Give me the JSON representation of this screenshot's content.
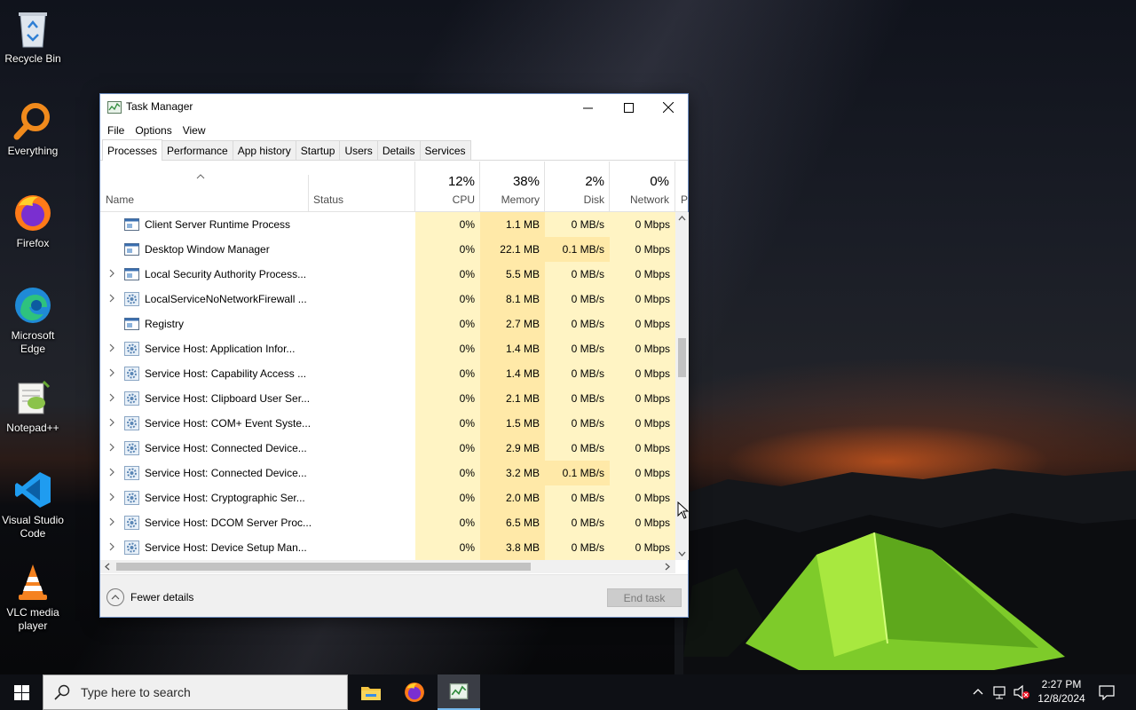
{
  "desktop": {
    "icons": [
      {
        "label": "Recycle Bin",
        "icon": "recycle-bin-icon"
      },
      {
        "label": "Everything",
        "icon": "everything-search-icon"
      },
      {
        "label": "Firefox",
        "icon": "firefox-icon"
      },
      {
        "label": "Microsoft Edge",
        "icon": "edge-icon"
      },
      {
        "label": "Notepad++",
        "icon": "notepadpp-icon"
      },
      {
        "label": "Visual Studio Code",
        "icon": "vscode-icon"
      },
      {
        "label": "VLC media player",
        "icon": "vlc-icon"
      }
    ]
  },
  "window": {
    "title": "Task Manager",
    "menu": [
      "File",
      "Options",
      "View"
    ],
    "tabs": [
      "Processes",
      "Performance",
      "App history",
      "Startup",
      "Users",
      "Details",
      "Services"
    ],
    "active_tab": "Processes",
    "columns": {
      "name": "Name",
      "status": "Status",
      "cpu": {
        "pct": "12%",
        "label": "CPU"
      },
      "memory": {
        "pct": "38%",
        "label": "Memory"
      },
      "disk": {
        "pct": "2%",
        "label": "Disk"
      },
      "network": {
        "pct": "0%",
        "label": "Network"
      },
      "power_partial": "P"
    },
    "processes": [
      {
        "name": "Client Server Runtime Process",
        "expandable": false,
        "icon": "window-icon",
        "cpu": "0%",
        "memory": "1.1 MB",
        "disk": "0 MB/s",
        "network": "0 Mbps"
      },
      {
        "name": "Desktop Window Manager",
        "expandable": false,
        "icon": "window-icon",
        "cpu": "0%",
        "memory": "22.1 MB",
        "disk": "0.1 MB/s",
        "network": "0 Mbps"
      },
      {
        "name": "Local Security Authority Process...",
        "expandable": true,
        "icon": "window-icon",
        "cpu": "0%",
        "memory": "5.5 MB",
        "disk": "0 MB/s",
        "network": "0 Mbps"
      },
      {
        "name": "LocalServiceNoNetworkFirewall ...",
        "expandable": true,
        "icon": "gear-icon",
        "cpu": "0%",
        "memory": "8.1 MB",
        "disk": "0 MB/s",
        "network": "0 Mbps"
      },
      {
        "name": "Registry",
        "expandable": false,
        "icon": "window-icon",
        "cpu": "0%",
        "memory": "2.7 MB",
        "disk": "0 MB/s",
        "network": "0 Mbps"
      },
      {
        "name": "Service Host: Application Infor...",
        "expandable": true,
        "icon": "gear-icon",
        "cpu": "0%",
        "memory": "1.4 MB",
        "disk": "0 MB/s",
        "network": "0 Mbps"
      },
      {
        "name": "Service Host: Capability Access ...",
        "expandable": true,
        "icon": "gear-icon",
        "cpu": "0%",
        "memory": "1.4 MB",
        "disk": "0 MB/s",
        "network": "0 Mbps"
      },
      {
        "name": "Service Host: Clipboard User Ser...",
        "expandable": true,
        "icon": "gear-icon",
        "cpu": "0%",
        "memory": "2.1 MB",
        "disk": "0 MB/s",
        "network": "0 Mbps"
      },
      {
        "name": "Service Host: COM+ Event Syste...",
        "expandable": true,
        "icon": "gear-icon",
        "cpu": "0%",
        "memory": "1.5 MB",
        "disk": "0 MB/s",
        "network": "0 Mbps"
      },
      {
        "name": "Service Host: Connected Device...",
        "expandable": true,
        "icon": "gear-icon",
        "cpu": "0%",
        "memory": "2.9 MB",
        "disk": "0 MB/s",
        "network": "0 Mbps"
      },
      {
        "name": "Service Host: Connected Device...",
        "expandable": true,
        "icon": "gear-icon",
        "cpu": "0%",
        "memory": "3.2 MB",
        "disk": "0.1 MB/s",
        "network": "0 Mbps"
      },
      {
        "name": "Service Host: Cryptographic Ser...",
        "expandable": true,
        "icon": "gear-icon",
        "cpu": "0%",
        "memory": "2.0 MB",
        "disk": "0 MB/s",
        "network": "0 Mbps"
      },
      {
        "name": "Service Host: DCOM Server Proc...",
        "expandable": true,
        "icon": "gear-icon",
        "cpu": "0%",
        "memory": "6.5 MB",
        "disk": "0 MB/s",
        "network": "0 Mbps"
      },
      {
        "name": "Service Host: Device Setup Man...",
        "expandable": true,
        "icon": "gear-icon",
        "cpu": "0%",
        "memory": "3.8 MB",
        "disk": "0 MB/s",
        "network": "0 Mbps"
      }
    ],
    "footer": {
      "fewer_details": "Fewer details",
      "end_task": "End task"
    }
  },
  "colors": {
    "heat_light": "#fff4c4",
    "heat_medium": "#ffe9a8",
    "accent": "#0078d7"
  },
  "taskbar": {
    "search_placeholder": "Type here to search",
    "pinned": [
      "file-explorer-icon",
      "firefox-icon",
      "task-manager-icon"
    ],
    "active_app": "task-manager-icon",
    "clock": {
      "time": "2:27 PM",
      "date": "12/8/2024"
    }
  }
}
